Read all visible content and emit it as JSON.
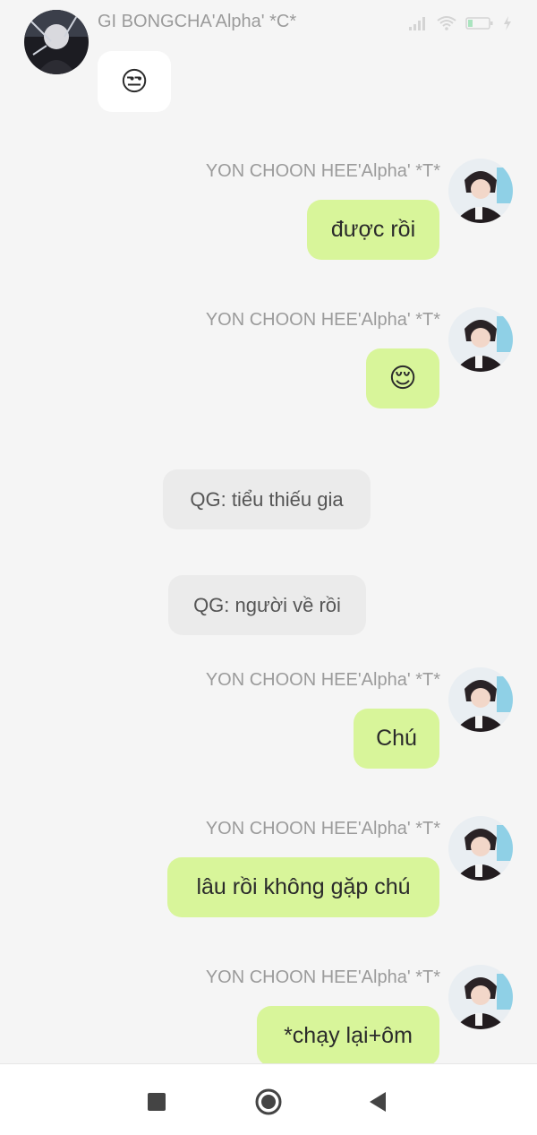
{
  "status_bar": {
    "icons": [
      "signal-icon",
      "wifi-icon",
      "battery-icon",
      "charging-icon"
    ]
  },
  "messages": [
    {
      "kind": "received",
      "sender": "GI BONGCHA'Alpha' *C*",
      "text": "😒"
    },
    {
      "kind": "sent",
      "sender": "YON CHOON HEE'Alpha' *T*",
      "text": "được rồi"
    },
    {
      "kind": "sent",
      "sender": "YON CHOON HEE'Alpha' *T*",
      "text": "😌"
    },
    {
      "kind": "system",
      "text": "QG: tiểu thiếu gia"
    },
    {
      "kind": "system",
      "text": "QG: người về rồi"
    },
    {
      "kind": "sent",
      "sender": "YON CHOON HEE'Alpha' *T*",
      "text": "Chú"
    },
    {
      "kind": "sent",
      "sender": "YON CHOON HEE'Alpha' *T*",
      "text": "lâu rồi không gặp chú"
    },
    {
      "kind": "sent",
      "sender": "YON CHOON HEE'Alpha' *T*",
      "text": "*chạy lại+ôm"
    }
  ],
  "colors": {
    "background": "#f5f5f5",
    "sent_bubble": "#d8f59a",
    "received_bubble": "#ffffff",
    "system_bubble": "#ebebeb",
    "name_text": "#9b9b9b"
  },
  "navigation": {
    "icons": [
      "recent-apps-icon",
      "home-icon",
      "back-icon"
    ]
  }
}
